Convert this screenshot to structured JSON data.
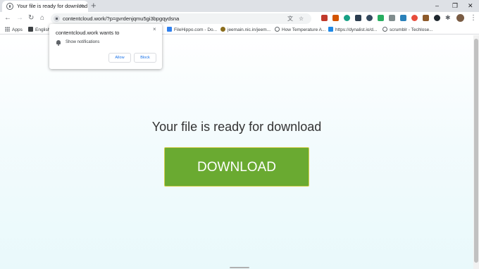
{
  "browser": {
    "tab": {
      "title": "Your file is ready for download",
      "close_icon": "×"
    },
    "new_tab_label": "+",
    "window_controls": {
      "minimize": "–",
      "restore": "❐",
      "close": "✕"
    },
    "nav": {
      "back": "←",
      "forward": "→",
      "reload": "↻",
      "home": "⌂"
    },
    "url": "contentcloud.work/?p=gvrdenjqmu5gi3bpgqydsna",
    "menu_label": "⋮"
  },
  "bookmarks": [
    {
      "label": "Apps",
      "icon": "apps-grid-icon"
    },
    {
      "label": "English",
      "icon": "bookmark-icon"
    },
    {
      "label": "FileHippo.com - Do...",
      "icon": "filehippo-icon"
    },
    {
      "label": "jeemain.nic.in/jeem...",
      "icon": "jeemain-icon"
    },
    {
      "label": "How Temperature A...",
      "icon": "globe-icon"
    },
    {
      "label": "https://dynalist.io/d...",
      "icon": "dynalist-icon"
    },
    {
      "label": "scrumblr - Techlose...",
      "icon": "globe-icon"
    }
  ],
  "notification_prompt": {
    "title": "contentcloud.work wants to",
    "permission": "Show notifications",
    "allow_label": "Allow",
    "block_label": "Block",
    "close_icon": "×"
  },
  "page": {
    "headline": "Your file is ready for download",
    "download_label": "DOWNLOAD"
  },
  "colors": {
    "download_button": "#6aaa31",
    "download_border": "#d7cf52",
    "link_blue": "#1a73e8"
  }
}
